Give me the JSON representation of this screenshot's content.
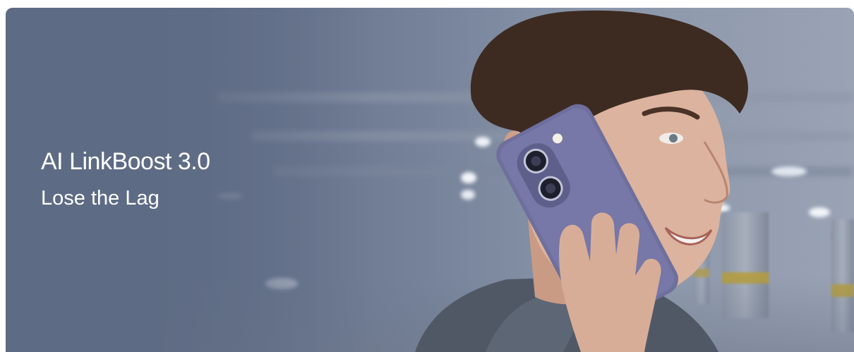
{
  "banner": {
    "headline": "AI LinkBoost 3.0",
    "subline": "Lose the Lag",
    "image_name": "man-on-phone-call-photo",
    "colors": {
      "background": "#66738c",
      "text": "#ffffff",
      "phone": "#6f6f9a"
    }
  }
}
